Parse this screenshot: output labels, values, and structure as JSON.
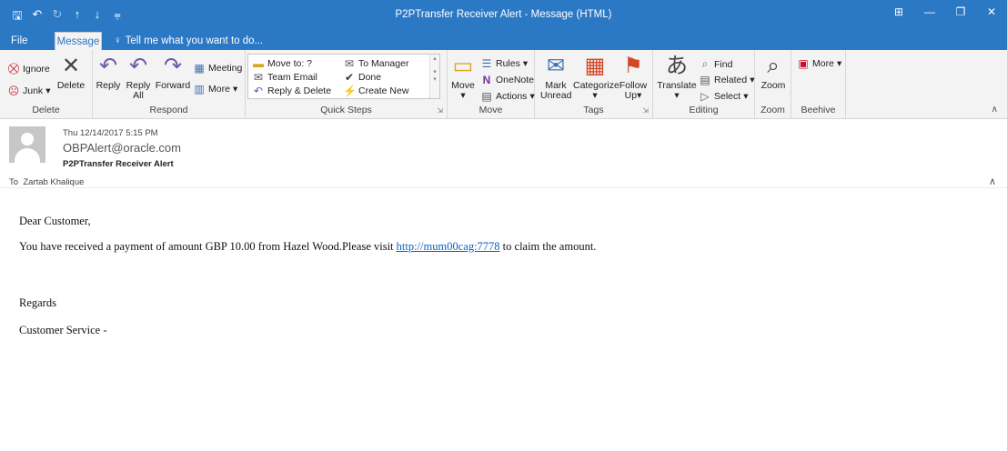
{
  "window": {
    "title": "P2PTransfer Receiver Alert  -  Message (HTML)",
    "qat_icons": [
      "save-icon",
      "undo-icon",
      "redo-icon",
      "up-arrow-icon",
      "down-arrow-icon",
      "customize-icon"
    ],
    "controls": [
      "ribbon-display-icon",
      "minimize-icon",
      "restore-icon",
      "close-icon"
    ]
  },
  "tabs": {
    "file": "File",
    "message": "Message",
    "tell_me": "Tell me what you want to do..."
  },
  "ribbon": {
    "delete_group": {
      "ignore": "Ignore",
      "junk": "Junk",
      "delete": "Delete",
      "label": "Delete"
    },
    "respond_group": {
      "reply": "Reply",
      "reply_all_1": "Reply",
      "reply_all_2": "All",
      "forward": "Forward",
      "meeting": "Meeting",
      "more": "More",
      "label": "Respond"
    },
    "quick_steps": {
      "items": [
        "Move to: ?",
        "To Manager",
        "Team Email",
        "Done",
        "Reply & Delete",
        "Create New"
      ],
      "label": "Quick Steps"
    },
    "move_group": {
      "move": "Move",
      "rules": "Rules",
      "onenote": "OneNote",
      "actions": "Actions",
      "label": "Move"
    },
    "tags_group": {
      "mark_unread_1": "Mark",
      "mark_unread_2": "Unread",
      "categorize": "Categorize",
      "follow_up_1": "Follow",
      "follow_up_2": "Up",
      "label": "Tags"
    },
    "editing_group": {
      "translate": "Translate",
      "find": "Find",
      "related": "Related",
      "select": "Select",
      "label": "Editing"
    },
    "zoom_group": {
      "zoom": "Zoom",
      "label": "Zoom"
    },
    "beehive_group": {
      "more": "More",
      "label": "Beehive"
    }
  },
  "message": {
    "date": "Thu 12/14/2017 5:15 PM",
    "from": "OBPAlert@oracle.com",
    "subject": "P2PTransfer Receiver Alert",
    "to_label": "To",
    "to": "Zartab Khalique",
    "body": {
      "greeting": "Dear Customer,",
      "line_pre": "You have received a payment of amount GBP 10.00 from Hazel Wood.Please visit ",
      "link": "http://mum00cag:7778",
      "line_post": " to claim the amount.",
      "regards": "Regards",
      "signature": "Customer Service -"
    }
  }
}
